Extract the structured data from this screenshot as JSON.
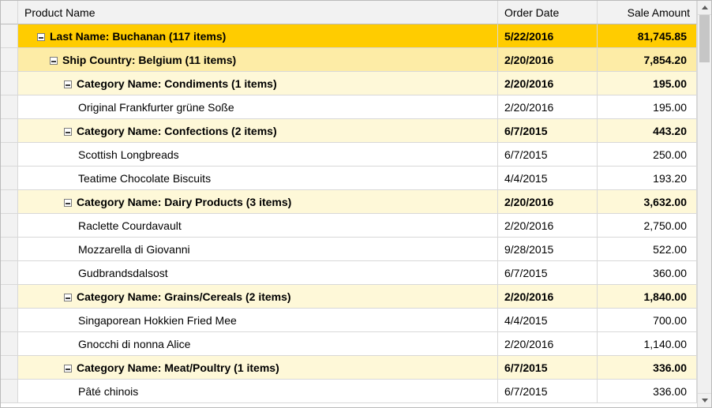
{
  "columns": {
    "name_header": "Product Name",
    "date_header": "Order Date",
    "amount_header": "Sale Amount"
  },
  "rows": [
    {
      "kind": "group",
      "groupLevel": 0,
      "indent": 18,
      "label": "Last Name: Buchanan (117 items)",
      "date": "5/22/2016",
      "amount": "81,745.85"
    },
    {
      "kind": "group",
      "groupLevel": 1,
      "indent": 34,
      "label": "Ship Country: Belgium (11 items)",
      "date": "2/20/2016",
      "amount": "7,854.20"
    },
    {
      "kind": "group",
      "groupLevel": 2,
      "indent": 52,
      "label": "Category Name: Condiments (1 items)",
      "date": "2/20/2016",
      "amount": "195.00"
    },
    {
      "kind": "data",
      "indent": 70,
      "label": "Original Frankfurter grüne Soße",
      "date": "2/20/2016",
      "amount": "195.00"
    },
    {
      "kind": "group",
      "groupLevel": 2,
      "indent": 52,
      "label": "Category Name: Confections (2 items)",
      "date": "6/7/2015",
      "amount": "443.20"
    },
    {
      "kind": "data",
      "indent": 70,
      "label": "Scottish Longbreads",
      "date": "6/7/2015",
      "amount": "250.00"
    },
    {
      "kind": "data",
      "indent": 70,
      "label": "Teatime Chocolate Biscuits",
      "date": "4/4/2015",
      "amount": "193.20"
    },
    {
      "kind": "group",
      "groupLevel": 2,
      "indent": 52,
      "label": "Category Name: Dairy Products (3 items)",
      "date": "2/20/2016",
      "amount": "3,632.00"
    },
    {
      "kind": "data",
      "indent": 70,
      "label": "Raclette Courdavault",
      "date": "2/20/2016",
      "amount": "2,750.00"
    },
    {
      "kind": "data",
      "indent": 70,
      "label": "Mozzarella di Giovanni",
      "date": "9/28/2015",
      "amount": "522.00"
    },
    {
      "kind": "data",
      "indent": 70,
      "label": "Gudbrandsdalsost",
      "date": "6/7/2015",
      "amount": "360.00"
    },
    {
      "kind": "group",
      "groupLevel": 2,
      "indent": 52,
      "label": "Category Name: Grains/Cereals (2 items)",
      "date": "2/20/2016",
      "amount": "1,840.00"
    },
    {
      "kind": "data",
      "indent": 70,
      "label": "Singaporean Hokkien Fried Mee",
      "date": "4/4/2015",
      "amount": "700.00"
    },
    {
      "kind": "data",
      "indent": 70,
      "label": "Gnocchi di nonna Alice",
      "date": "2/20/2016",
      "amount": "1,140.00"
    },
    {
      "kind": "group",
      "groupLevel": 2,
      "indent": 52,
      "label": "Category Name: Meat/Poultry (1 items)",
      "date": "6/7/2015",
      "amount": "336.00"
    },
    {
      "kind": "data",
      "indent": 70,
      "label": "Pâté chinois",
      "date": "6/7/2015",
      "amount": "336.00"
    }
  ]
}
